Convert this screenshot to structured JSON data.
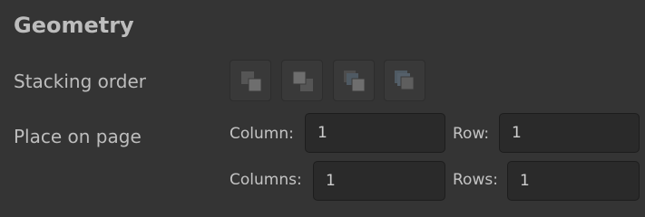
{
  "section": {
    "title": "Geometry"
  },
  "stacking": {
    "label": "Stacking order",
    "buttons": [
      {
        "name": "bring-to-front",
        "icon": "bring-to-front-icon"
      },
      {
        "name": "send-to-back",
        "icon": "send-to-back-icon"
      },
      {
        "name": "bring-forward",
        "icon": "bring-forward-icon"
      },
      {
        "name": "send-backward",
        "icon": "send-backward-icon"
      }
    ]
  },
  "place": {
    "label": "Place on page",
    "column_label": "Column:",
    "column_value": "1",
    "row_label": "Row:",
    "row_value": "1",
    "columns_label": "Columns:",
    "columns_value": "1",
    "rows_label": "Rows:",
    "rows_value": "1"
  },
  "colors": {
    "background": "#343434",
    "field_background": "#2a2a2a",
    "text": "#c8c8c8"
  }
}
